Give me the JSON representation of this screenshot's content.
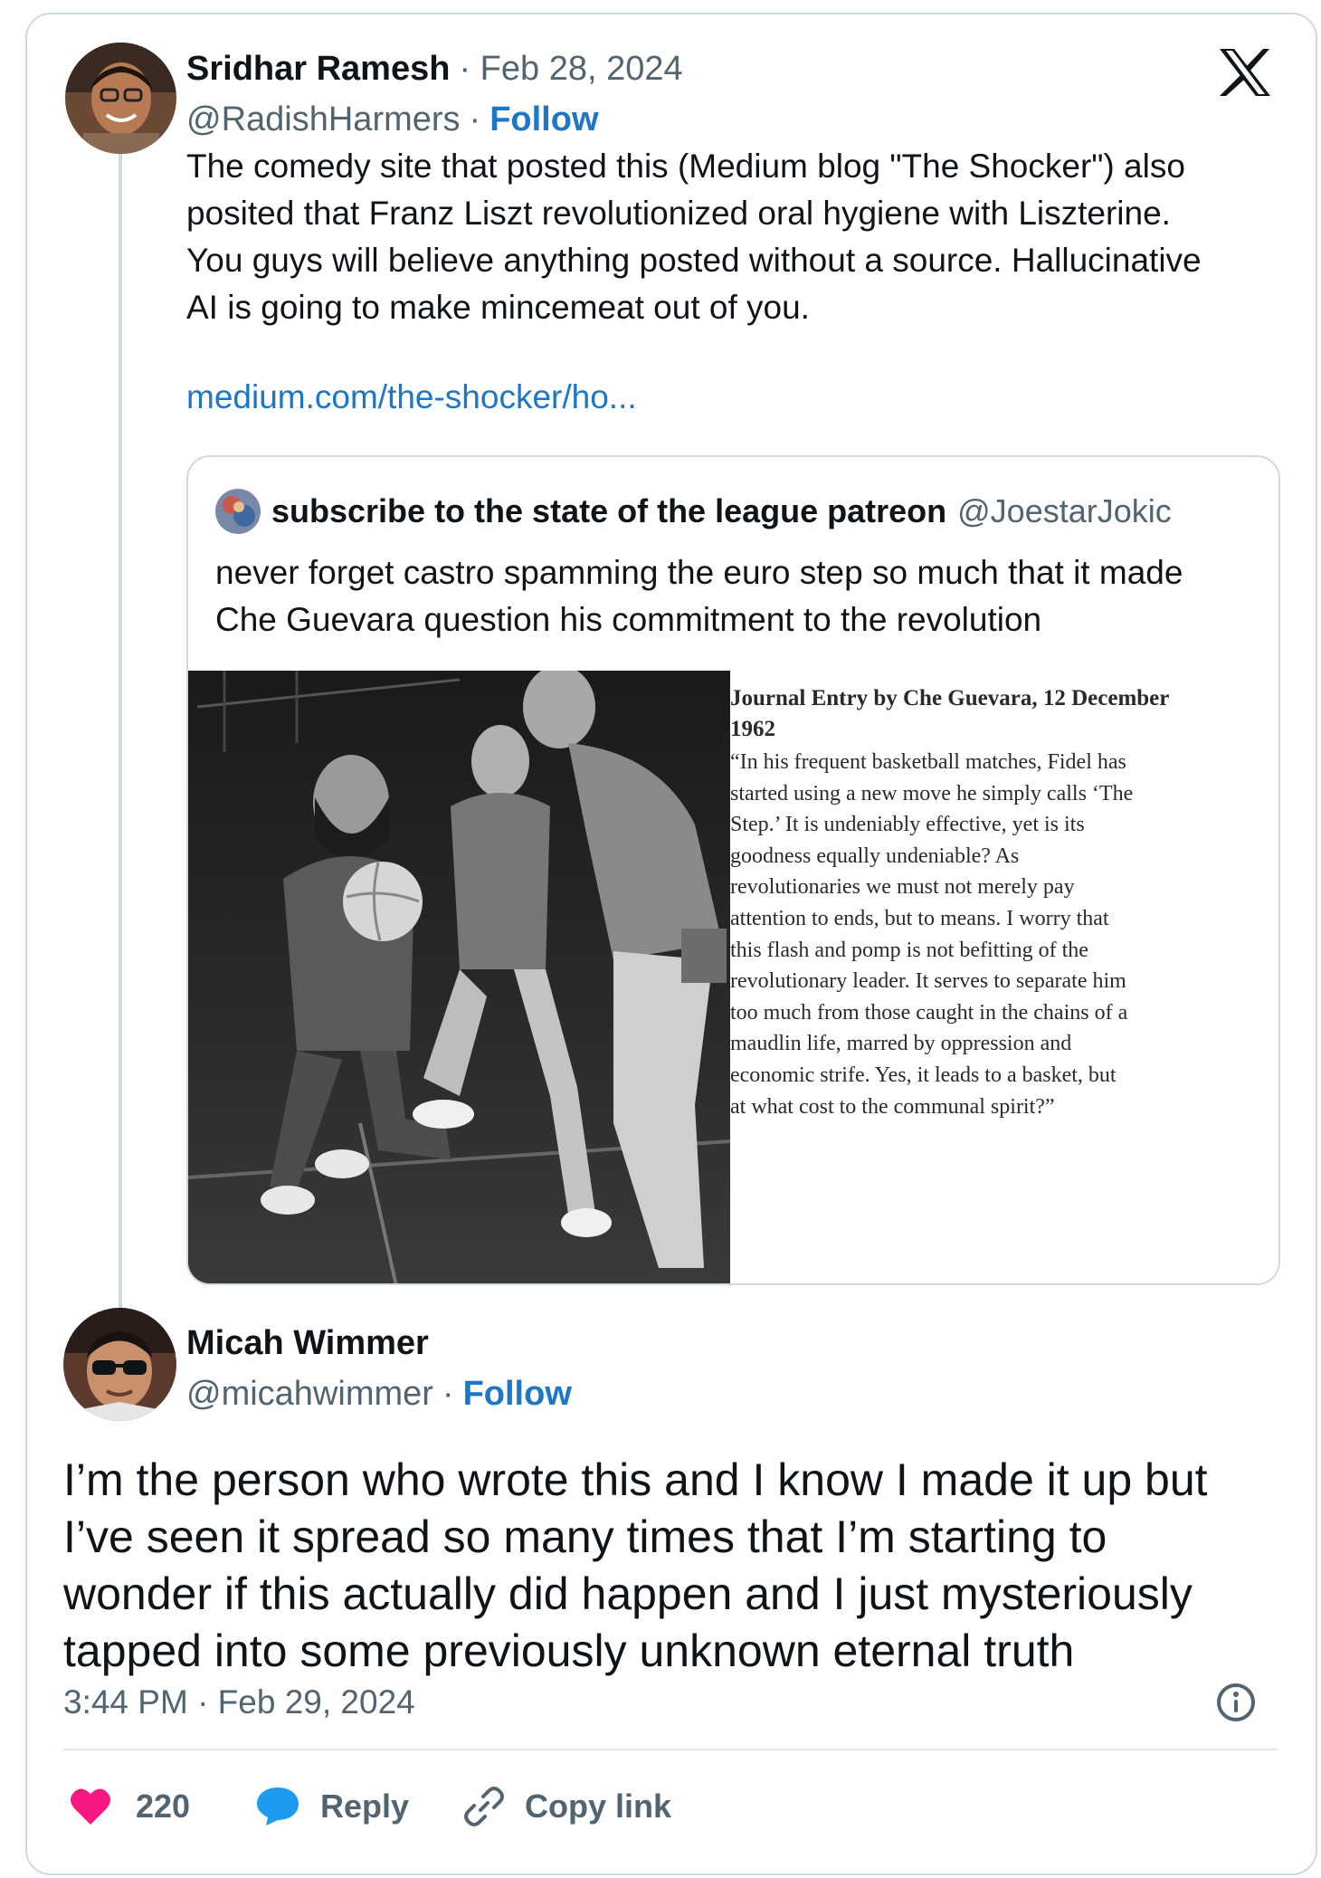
{
  "tweet_parent": {
    "author_name": "Sridhar Ramesh",
    "date": "· Feb 28, 2024",
    "handle": "@RadishHarmers",
    "separator": "·",
    "follow_label": "Follow",
    "text_lines": [
      "The comedy site that posted this (Medium blog \"The Shocker\") also",
      "posited that Franz Liszt revolutionized oral hygiene with Liszterine.",
      "You guys will believe anything posted without a source. Hallucinative",
      "AI is going to make mincemeat out of you."
    ],
    "link": "medium.com/the-shocker/ho..."
  },
  "quoted_tweet": {
    "author_name": "subscribe to the state of the league patreon",
    "handle": "@JoestarJokic",
    "text_lines": [
      "never forget castro spamming the euro step so much that it made",
      "Che Guevara question his commitment to the revolution"
    ],
    "journal_title_lines": [
      "Journal Entry by Che Guevara, 12 December",
      "1962"
    ],
    "journal_body_lines": [
      "“In his frequent basketball matches, Fidel has",
      "started using a new move he simply calls ‘The",
      "Step.’ It is undeniably effective, yet is its",
      "goodness equally undeniable? As",
      "revolutionaries we must not merely pay",
      "attention to ends, but to means. I worry that",
      "this flash and pomp is not befitting of the",
      "revolutionary leader. It serves to separate him",
      "too much from those caught in the chains of a",
      "maudlin life, marred by oppression and",
      "economic strife. Yes, it leads to a basket, but",
      "at what cost to the communal spirit?”"
    ]
  },
  "tweet_reply": {
    "author_name": "Micah Wimmer",
    "handle": "@micahwimmer",
    "separator": "·",
    "follow_label": "Follow",
    "text_lines": [
      "I’m the person who wrote this and I know I made it up but",
      "I’ve seen it spread so many times that I’m starting to",
      "wonder if this actually did happen and I just mysteriously",
      "tapped into some previously unknown eternal truth"
    ],
    "timestamp": "3:44 PM · Feb 29, 2024"
  },
  "actions": {
    "like_count": "220",
    "reply_label": "Reply",
    "copy_link_label": "Copy link"
  },
  "icons": {
    "platform_logo": "x-logo-icon",
    "info": "info-icon",
    "like": "heart-icon",
    "reply": "speech-bubble-icon",
    "copy_link": "link-icon"
  },
  "colors": {
    "link_blue": "#1d76c8",
    "like_pink": "#f91880",
    "reply_blue": "#1d9bf0",
    "border": "#cfd9de",
    "muted_text": "#536471"
  }
}
